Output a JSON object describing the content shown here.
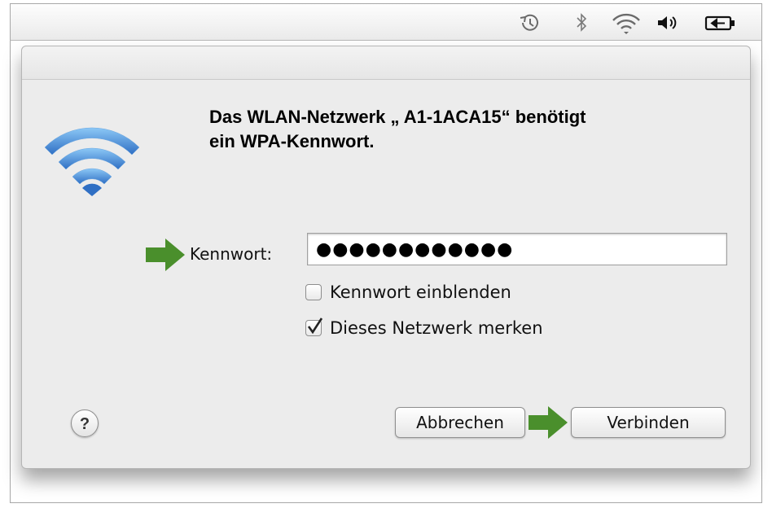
{
  "menubar": {
    "icons": [
      "time-machine-icon",
      "bluetooth-icon",
      "wifi-icon",
      "volume-icon",
      "battery-icon"
    ]
  },
  "dialog": {
    "title_line1": "Das WLAN-Netzwerk „ A1-1ACA15“ benötigt",
    "title_line2": "ein WPA-Kennwort.",
    "password_label": "Kennwort:",
    "password_value": "●●●●●●●●●●●●",
    "show_password_label": "Kennwort einblenden",
    "show_password_checked": false,
    "remember_label": "Dieses Netzwerk merken",
    "remember_checked": true,
    "help_label": "?",
    "cancel_label": "Abbrechen",
    "connect_label": "Verbinden"
  },
  "colors": {
    "arrow_green": "#4a8f2c",
    "wifi_blue": "#3d8fde"
  }
}
